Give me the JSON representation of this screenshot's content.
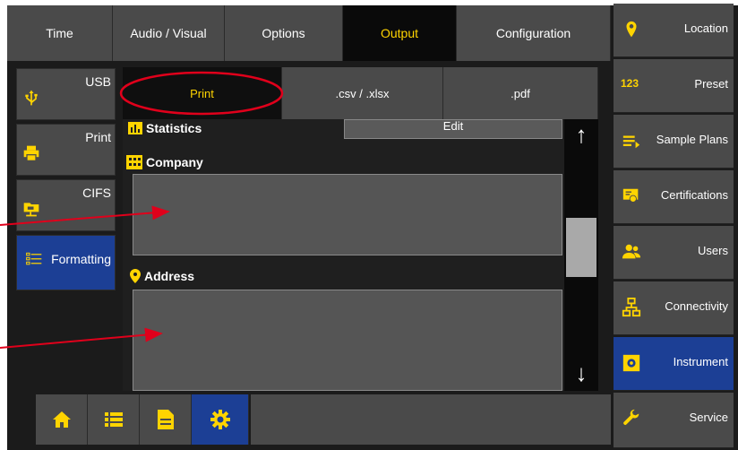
{
  "top_tabs": [
    {
      "label": "Time"
    },
    {
      "label": "Audio / Visual"
    },
    {
      "label": "Options"
    },
    {
      "label": "Output",
      "active": true
    },
    {
      "label": "Configuration"
    }
  ],
  "right_nav": [
    {
      "label": "Location",
      "icon": "location-pin-icon"
    },
    {
      "label": "Preset",
      "icon": "preset-123-icon",
      "icon_text": "123"
    },
    {
      "label": "Sample Plans",
      "icon": "sample-plans-icon"
    },
    {
      "label": "Certifications",
      "icon": "certificate-icon"
    },
    {
      "label": "Users",
      "icon": "users-icon"
    },
    {
      "label": "Connectivity",
      "icon": "network-icon"
    },
    {
      "label": "Instrument",
      "icon": "instrument-gear-icon",
      "active": true
    },
    {
      "label": "Service",
      "icon": "wrench-icon"
    }
  ],
  "side_tabs": [
    {
      "label": "USB",
      "icon": "usb-icon"
    },
    {
      "label": "Print",
      "icon": "printer-icon"
    },
    {
      "label": "CIFS",
      "icon": "network-folder-icon"
    },
    {
      "label": "Formatting",
      "icon": "formatting-list-icon",
      "active": true
    }
  ],
  "sub_tabs": [
    {
      "label": "Print",
      "active": true
    },
    {
      "label": ".csv / .xlsx"
    },
    {
      "label": ".pdf"
    }
  ],
  "content": {
    "statistics_heading": "Statistics",
    "edit_label": "Edit",
    "company_label": "Company",
    "address_label": "Address"
  },
  "scrollbar": {
    "position": 0.45
  },
  "bottom_bar": [
    {
      "icon": "home-icon"
    },
    {
      "icon": "list-icon"
    },
    {
      "icon": "document-icon"
    },
    {
      "icon": "settings-gear-icon",
      "active": true
    }
  ],
  "colors": {
    "accent": "#ffd400",
    "active_blue": "#1c3f95",
    "button_gray": "#4a4a4a",
    "annotation_red": "#e0001b"
  }
}
